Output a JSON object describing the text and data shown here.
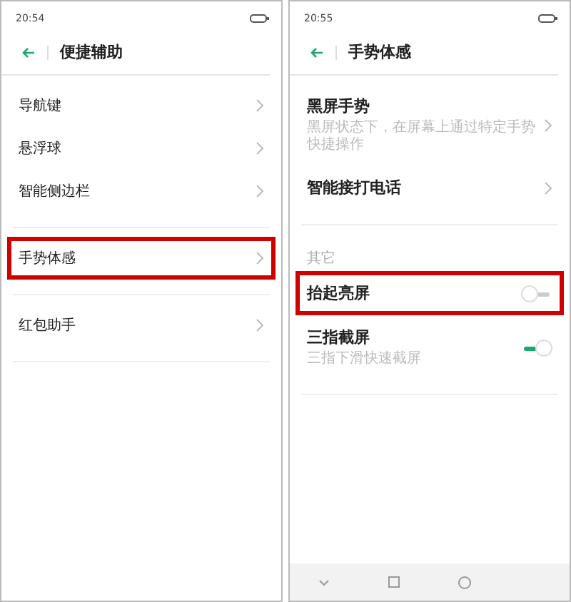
{
  "screens": [
    {
      "status_bar": {
        "time": "20:54"
      },
      "title": "便捷辅助",
      "sections": [
        {
          "items": [
            {
              "label": "导航键",
              "kind": "link",
              "highlighted": false
            },
            {
              "label": "悬浮球",
              "kind": "link",
              "highlighted": false
            },
            {
              "label": "智能侧边栏",
              "kind": "link",
              "highlighted": false
            }
          ]
        },
        {
          "items": [
            {
              "label": "手势体感",
              "kind": "link",
              "highlighted": true
            }
          ]
        },
        {
          "items": [
            {
              "label": "红包助手",
              "kind": "link",
              "highlighted": false
            }
          ]
        }
      ],
      "nav_bar": false
    },
    {
      "status_bar": {
        "time": "20:55"
      },
      "title": "手势体感",
      "sections": [
        {
          "items": [
            {
              "label": "黑屏手势",
              "subtitle": "黑屏状态下，在屏幕上通过特定手势快捷操作",
              "kind": "link",
              "highlighted": false
            },
            {
              "label": "智能接打电话",
              "kind": "link",
              "highlighted": false
            }
          ]
        },
        {
          "header": "其它",
          "items": [
            {
              "label": "抬起亮屏",
              "kind": "toggle",
              "on": false,
              "highlighted": true
            },
            {
              "label": "三指截屏",
              "subtitle": "三指下滑快速截屏",
              "kind": "toggle",
              "on": true,
              "highlighted": false
            }
          ]
        }
      ],
      "nav_bar": true
    }
  ]
}
